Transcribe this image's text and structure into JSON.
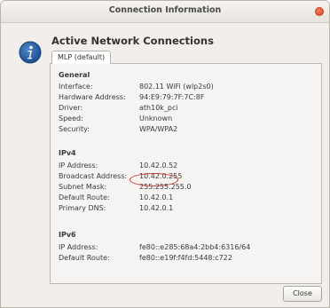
{
  "window": {
    "title": "Connection Information",
    "close_button_label": "Close"
  },
  "header": {
    "heading": "Active Network Connections",
    "tab_label": "MLP (default)"
  },
  "general": {
    "title": "General",
    "rows": [
      {
        "label": "Interface:",
        "value": "802.11 WiFi (wlp2s0)"
      },
      {
        "label": "Hardware Address:",
        "value": "94:E9:79:7F:7C:8F"
      },
      {
        "label": "Driver:",
        "value": "ath10k_pci"
      },
      {
        "label": "Speed:",
        "value": "Unknown"
      },
      {
        "label": "Security:",
        "value": "WPA/WPA2"
      }
    ]
  },
  "ipv4": {
    "title": "IPv4",
    "rows": [
      {
        "label": "IP Address:",
        "value": "10.42.0.52"
      },
      {
        "label": "Broadcast Address:",
        "value": "10.42.0.255"
      },
      {
        "label": "Subnet Mask:",
        "value": "255.255.255.0"
      },
      {
        "label": "Default Route:",
        "value": "10.42.0.1"
      },
      {
        "label": "Primary DNS:",
        "value": "10.42.0.1"
      }
    ]
  },
  "ipv6": {
    "title": "IPv6",
    "rows": [
      {
        "label": "IP Address:",
        "value": "fe80::e285:68a4:2bb4:6316/64"
      },
      {
        "label": "Default Route:",
        "value": "fe80::e19f:f4fd:5448:c722"
      }
    ]
  },
  "colors": {
    "highlight": "#c23a33",
    "info_icon": "#1d4f8f"
  },
  "icons": {
    "info": "info-icon",
    "window_close": "close-icon"
  }
}
